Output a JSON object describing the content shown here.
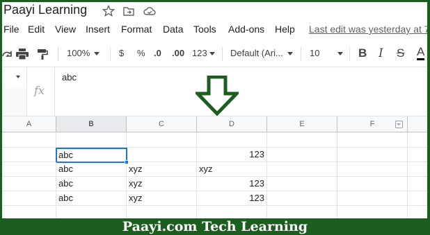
{
  "header": {
    "title": "Paayi Learning"
  },
  "menu": {
    "items": [
      "File",
      "Edit",
      "View",
      "Insert",
      "Format",
      "Data",
      "Tools",
      "Add-ons",
      "Help"
    ],
    "last_edit": "Last edit was yesterday at 7"
  },
  "toolbar": {
    "zoom": "100%",
    "currency": "$",
    "percent": "%",
    "dec_decrease": ".0",
    "dec_increase": ".00",
    "more_formats": "123",
    "font": "Default (Ari...",
    "font_size": "10",
    "bold": "B",
    "italic": "I",
    "strike": "S",
    "text_color": "A"
  },
  "formula_bar": {
    "fx": "fx",
    "value": "abc"
  },
  "grid": {
    "columns": [
      "A",
      "B",
      "C",
      "D",
      "E",
      "F"
    ],
    "rows": [
      [
        "",
        "",
        "",
        "",
        "",
        ""
      ],
      [
        "",
        "abc",
        "",
        "123",
        "",
        ""
      ],
      [
        "",
        "abc",
        "xyz",
        "xyz",
        "",
        ""
      ],
      [
        "",
        "abc",
        "xyz",
        "123",
        "",
        ""
      ],
      [
        "",
        "abc",
        "xyz",
        "123",
        "",
        ""
      ],
      [
        "",
        "",
        "",
        "",
        "",
        ""
      ]
    ]
  },
  "footer": {
    "text": "Paayi.com Tech Learning"
  },
  "colors": {
    "frame": "#1b5e20",
    "accent": "#1a73e8",
    "arrow": "#1b5e20"
  }
}
